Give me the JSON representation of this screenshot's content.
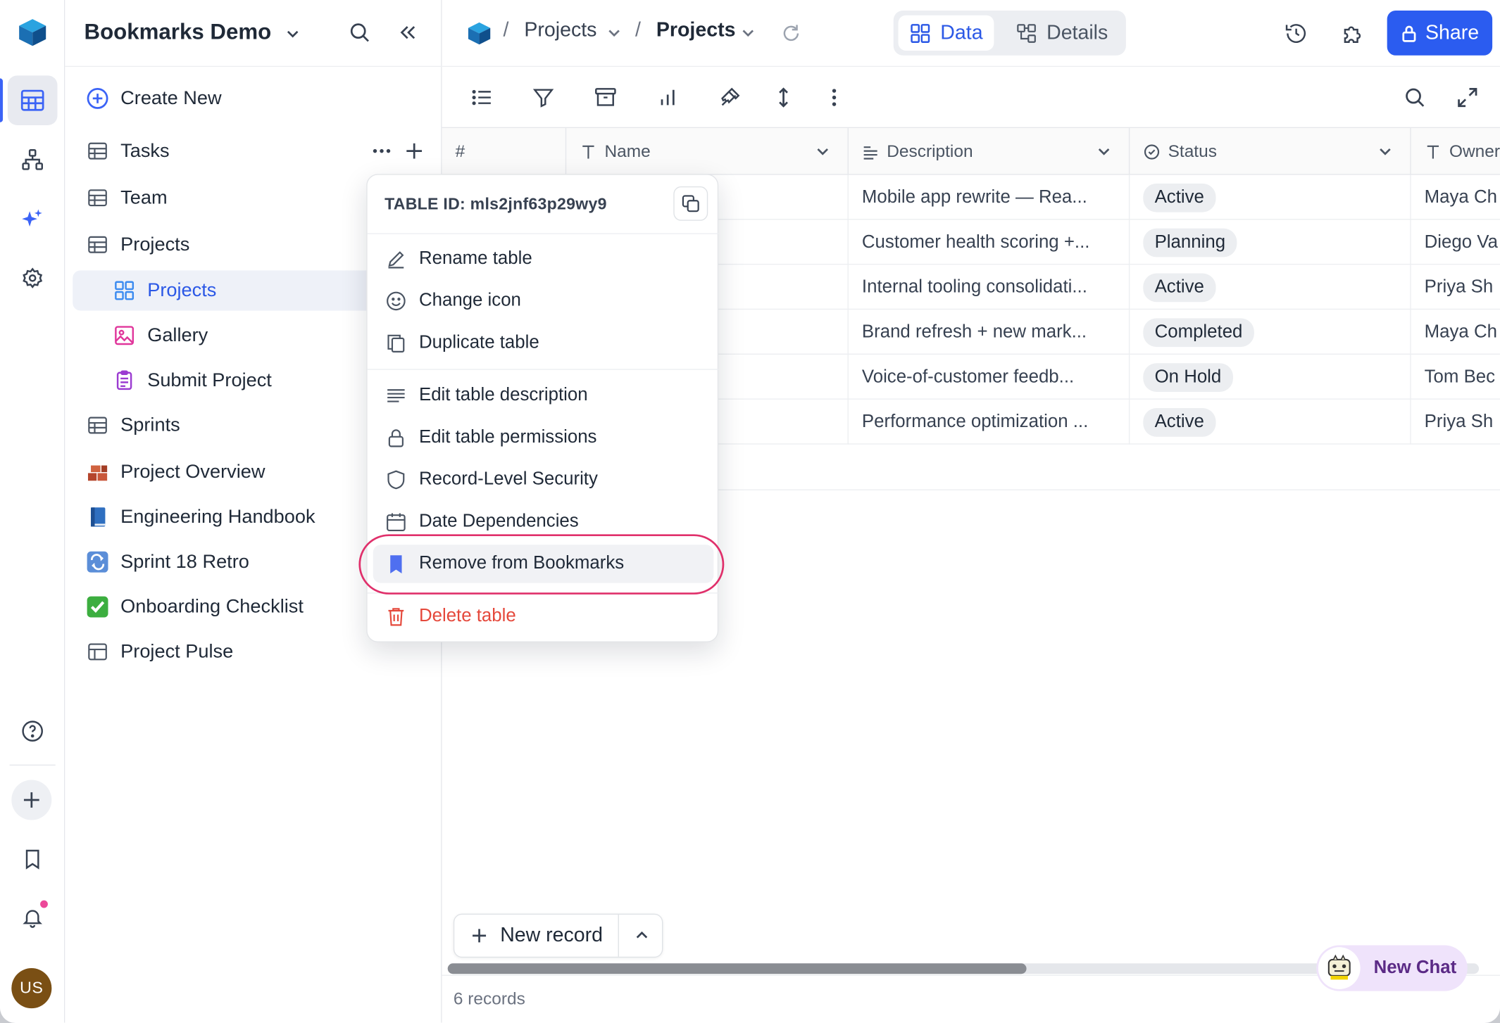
{
  "workspace": {
    "name": "Bookmarks Demo"
  },
  "rail": {
    "avatar_initials": "US"
  },
  "sidebar": {
    "create_new": "Create New",
    "items": [
      {
        "label": "Tasks",
        "icon": "table-icon"
      },
      {
        "label": "Team",
        "icon": "table-icon"
      },
      {
        "label": "Projects",
        "icon": "table-icon"
      },
      {
        "label": "Projects",
        "icon": "grid-view-icon"
      },
      {
        "label": "Gallery",
        "icon": "gallery-icon"
      },
      {
        "label": "Submit Project",
        "icon": "form-icon"
      },
      {
        "label": "Sprints",
        "icon": "table-icon"
      },
      {
        "label": "Project Overview",
        "icon": "bricks-emoji"
      },
      {
        "label": "Engineering Handbook",
        "icon": "book-emoji"
      },
      {
        "label": "Sprint 18 Retro",
        "icon": "repeat-emoji"
      },
      {
        "label": "Onboarding Checklist",
        "icon": "checkmark-emoji"
      },
      {
        "label": "Project Pulse",
        "icon": "dashboard-icon"
      }
    ]
  },
  "breadcrumb": {
    "first": "Projects",
    "second": "Projects"
  },
  "view_switch": {
    "data": "Data",
    "details": "Details"
  },
  "share_label": "Share",
  "columns": [
    "#",
    "Name",
    "Description",
    "Status",
    "Owner"
  ],
  "rows": [
    {
      "description": "Mobile app rewrite — Rea...",
      "status": "Active",
      "owner": "Maya Ch"
    },
    {
      "description": "Customer health scoring +...",
      "status": "Planning",
      "owner": "Diego Va"
    },
    {
      "description": "Internal tooling consolidati...",
      "status": "Active",
      "owner": "Priya Sh"
    },
    {
      "description": "Brand refresh + new mark...",
      "status": "Completed",
      "owner": "Maya Ch"
    },
    {
      "description": "Voice-of-customer feedb...",
      "status": "On Hold",
      "owner": "Tom Bec"
    },
    {
      "description": "Performance optimization ...",
      "status": "Active",
      "owner": "Priya Sh"
    }
  ],
  "new_record": "New record",
  "records_count": "6 records",
  "new_chat": "New Chat",
  "menu": {
    "table_id": "TABLE ID: mls2jnf63p29wy9",
    "items": [
      "Rename table",
      "Change icon",
      "Duplicate table",
      "Edit table description",
      "Edit table permissions",
      "Record-Level Security",
      "Date Dependencies",
      "Remove from Bookmarks",
      "Delete table"
    ]
  },
  "colors": {
    "accent": "#2b5cf0",
    "danger": "#e5483b",
    "highlight_ring": "#e0306b"
  }
}
